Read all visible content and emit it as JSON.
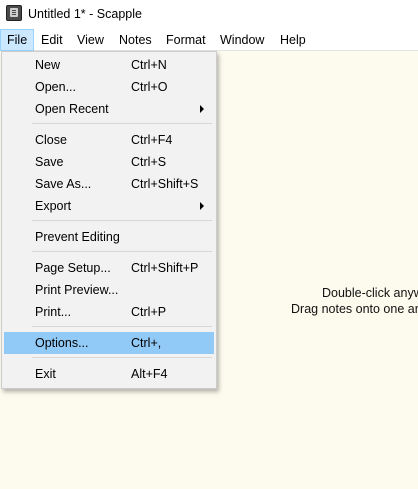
{
  "window": {
    "title": "Untitled 1* - Scapple",
    "app_icon": "scapple-app-icon"
  },
  "menubar": {
    "items": [
      "File",
      "Edit",
      "View",
      "Notes",
      "Format",
      "Window",
      "Help"
    ],
    "active": "File"
  },
  "file_menu": {
    "items": [
      {
        "label": "New",
        "shortcut": "Ctrl+N"
      },
      {
        "label": "Open...",
        "shortcut": "Ctrl+O"
      },
      {
        "label": "Open Recent",
        "shortcut": "",
        "submenu": true
      },
      {
        "label": "Close",
        "shortcut": "Ctrl+F4"
      },
      {
        "label": "Save",
        "shortcut": "Ctrl+S"
      },
      {
        "label": "Save As...",
        "shortcut": "Ctrl+Shift+S"
      },
      {
        "label": "Export",
        "shortcut": "",
        "submenu": true
      },
      {
        "label": "Prevent Editing",
        "shortcut": ""
      },
      {
        "label": "Page Setup...",
        "shortcut": "Ctrl+Shift+P"
      },
      {
        "label": "Print Preview...",
        "shortcut": ""
      },
      {
        "label": "Print...",
        "shortcut": "Ctrl+P"
      },
      {
        "label": "Options...",
        "shortcut": "Ctrl+,",
        "highlighted": true
      },
      {
        "label": "Exit",
        "shortcut": "Alt+F4"
      }
    ]
  },
  "canvas": {
    "hint_line1": "Double-click anyw",
    "hint_line2": "Drag notes onto one ar",
    "background": "#fdfbee"
  },
  "colors": {
    "menu_highlight": "#91c9f7",
    "menubar_active": "#cce8ff"
  }
}
